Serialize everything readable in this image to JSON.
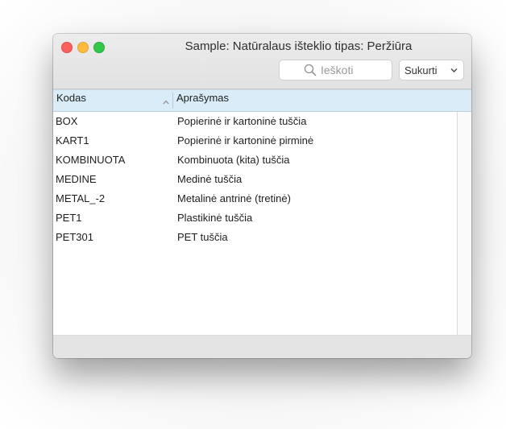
{
  "window": {
    "title": "Sample: Natūralaus ištekli­o tipas: Peržiūra"
  },
  "toolbar": {
    "search_placeholder": "Ieškoti",
    "create_label": "Sukurti"
  },
  "table": {
    "columns": [
      "Kodas",
      "Aprašymas"
    ],
    "sort": {
      "column": "Kodas",
      "direction": "ascending"
    },
    "rows": [
      {
        "code": "BOX",
        "description": "Popierinė ir kartoninė tuščia"
      },
      {
        "code": "KART1",
        "description": "Popierinė ir kartoninė pirminė"
      },
      {
        "code": "KOMBINUOTA",
        "description": "Kombinuota (kita) tuščia"
      },
      {
        "code": "MEDINE",
        "description": "Medinė tuščia"
      },
      {
        "code": "METAL_-2",
        "description": "Metalinė antrinė (tretinė)"
      },
      {
        "code": "PET1",
        "description": "Plastikinė tuščia"
      },
      {
        "code": "PET301",
        "description": "PET tuščia"
      }
    ]
  },
  "icons": {
    "search": "search-icon",
    "dropdown": "chevron-down-icon",
    "sort": "sort-ascending-icon"
  },
  "colors": {
    "header_bg": "#d9ecf7",
    "close": "#fc605c",
    "minimize": "#fdbc40",
    "maximize": "#34c84a"
  }
}
